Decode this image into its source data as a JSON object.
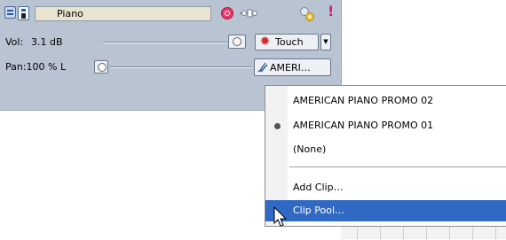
{
  "track": {
    "name": "Piano",
    "vol_label": "Vol:",
    "vol_value": "3.1 dB",
    "pan_label": "Pan:100 % L",
    "automation_label": "Touch",
    "clip_label": "AMERI…",
    "excl_label": "!"
  },
  "menu": {
    "items": [
      {
        "label": "AMERICAN PIANO PROMO 02",
        "selected": false
      },
      {
        "label": "AMERICAN PIANO PROMO 01",
        "selected": true
      },
      {
        "label": "(None)",
        "selected": false
      }
    ],
    "actions": [
      {
        "label": "Add Clip…"
      },
      {
        "label": "Clip Pool…"
      }
    ],
    "highlighted": "Clip Pool…"
  },
  "colors": {
    "panel_bg": "#b9c4d3",
    "highlight": "#316ac5",
    "name_field_bg": "#e9e4cf",
    "record_color": "#e43a66"
  }
}
